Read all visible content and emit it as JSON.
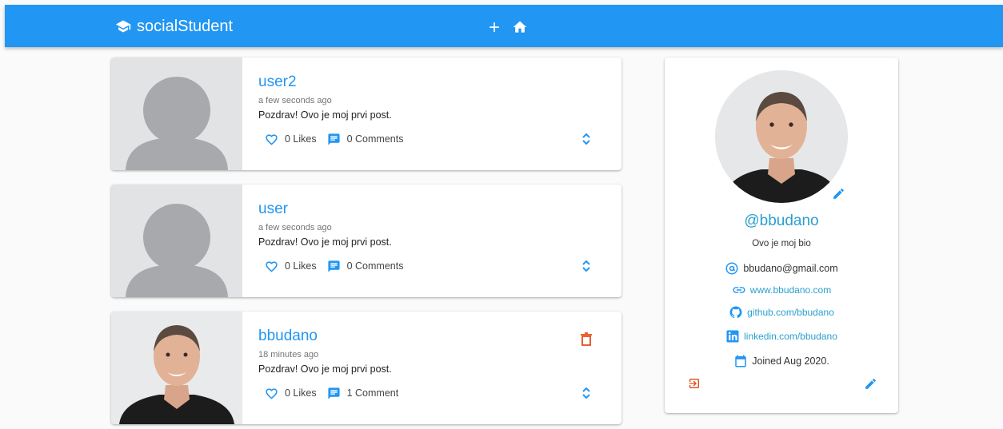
{
  "app": {
    "title": "socialStudent"
  },
  "colors": {
    "primary": "#2196f3",
    "link": "#2aa0cd",
    "danger": "#e64a19"
  },
  "nav": [
    {
      "name": "add-post",
      "icon": "plus-icon"
    },
    {
      "name": "home",
      "icon": "home-icon"
    }
  ],
  "posts": [
    {
      "user": "user2",
      "time": "a few seconds ago",
      "body": "Pozdrav! Ovo je moj prvi post.",
      "likes": "0 Likes",
      "comments": "0 Comments",
      "avatar": "placeholder",
      "deletable": false
    },
    {
      "user": "user",
      "time": "a few seconds ago",
      "body": "Pozdrav! Ovo je moj prvi post.",
      "likes": "0 Likes",
      "comments": "0 Comments",
      "avatar": "placeholder",
      "deletable": false
    },
    {
      "user": "bbudano",
      "time": "18 minutes ago",
      "body": "Pozdrav! Ovo je moj prvi post.",
      "likes": "0 Likes",
      "comments": "1 Comment",
      "avatar": "photo",
      "deletable": true
    }
  ],
  "profile": {
    "handle": "@bbudano",
    "bio": "Ovo je moj bio",
    "email": "bbudano@gmail.com",
    "website": "www.bbudano.com",
    "github": "github.com/bbudano",
    "linkedin": "linkedin.com/bbudano",
    "joined": "Joined Aug 2020."
  }
}
